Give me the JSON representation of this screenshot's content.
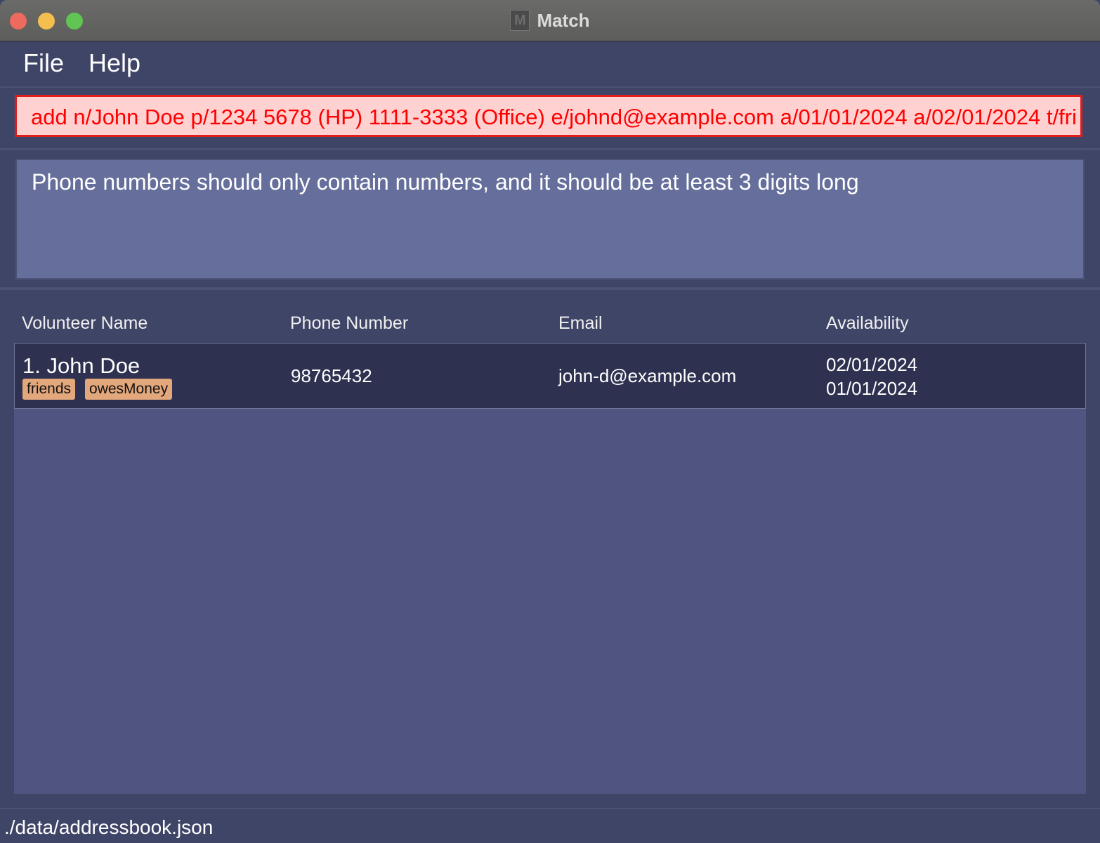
{
  "window": {
    "title": "Match",
    "icon": "app-icon",
    "controls": [
      "close",
      "minimize",
      "maximize"
    ]
  },
  "menu": {
    "file": "File",
    "help": "Help"
  },
  "command": {
    "value": "add n/John Doe p/1234 5678 (HP) 1111-3333 (Office) e/johnd@example.com a/01/01/2024 a/02/01/2024 t/fri",
    "error_color": "#ff0000"
  },
  "result": {
    "message": "Phone numbers should only contain numbers, and it should be at least 3 digits long"
  },
  "table": {
    "columns": {
      "name": "Volunteer Name",
      "phone": "Phone Number",
      "email": "Email",
      "availability": "Availability"
    },
    "rows": [
      {
        "name": "1. John Doe",
        "tags": [
          "friends",
          "owesMoney"
        ],
        "phone": "98765432",
        "email": "john-d@example.com",
        "availability": [
          "02/01/2024",
          "01/01/2024"
        ]
      }
    ]
  },
  "status": {
    "path": "./data/addressbook.json"
  },
  "colors": {
    "background": "#3f4567",
    "list_background": "#4f5580",
    "selected_row": "#2e3250",
    "tag": "#e3a77c",
    "error_input_bg": "#ffd1d1",
    "error_border": "#e21b1b"
  }
}
